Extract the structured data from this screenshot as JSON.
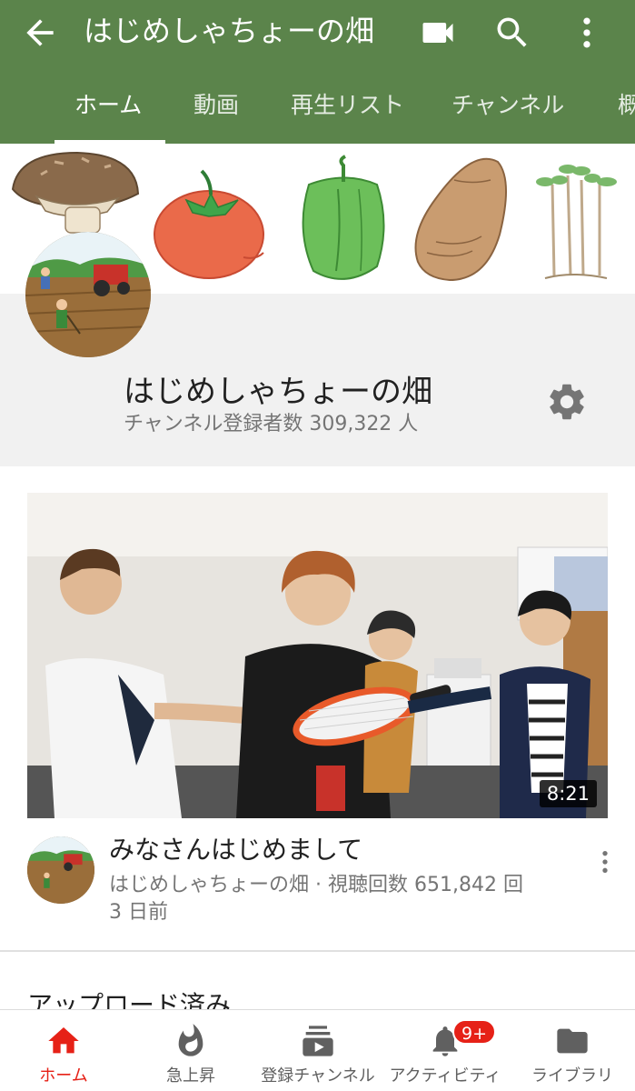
{
  "appbar": {
    "title": "はじめしゃちょーの畑",
    "back_icon": "arrow-left-icon",
    "actions": [
      "video-camera-icon",
      "search-icon",
      "more-vert-icon"
    ],
    "color": "#5b844b"
  },
  "tabs": [
    {
      "label": "ホーム",
      "active": true
    },
    {
      "label": "動画"
    },
    {
      "label": "再生リスト"
    },
    {
      "label": "チャンネル"
    },
    {
      "label": "概"
    }
  ],
  "channel": {
    "name": "はじめしゃちょーの畑",
    "subscribers": "チャンネル登録者数 309,322 人",
    "settings_icon": "gear-icon"
  },
  "featured_video": {
    "duration": "8:21",
    "title": "みなさんはじめまして",
    "meta": "はじめしゃちょーの畑 · 視聴回数 651,842 回",
    "date": "3 日前"
  },
  "uploads_section": {
    "title": "アップロード済み"
  },
  "bottom_nav": [
    {
      "label": "ホーム",
      "icon": "home-icon",
      "active": true
    },
    {
      "label": "急上昇",
      "icon": "flame-icon"
    },
    {
      "label": "登録チャンネル",
      "icon": "subscriptions-icon"
    },
    {
      "label": "アクティビティ",
      "icon": "bell-icon",
      "badge": "9+"
    },
    {
      "label": "ライブラリ",
      "icon": "folder-icon"
    }
  ],
  "colors": {
    "accent_red": "#e62117",
    "appbar_green": "#5b844b"
  }
}
